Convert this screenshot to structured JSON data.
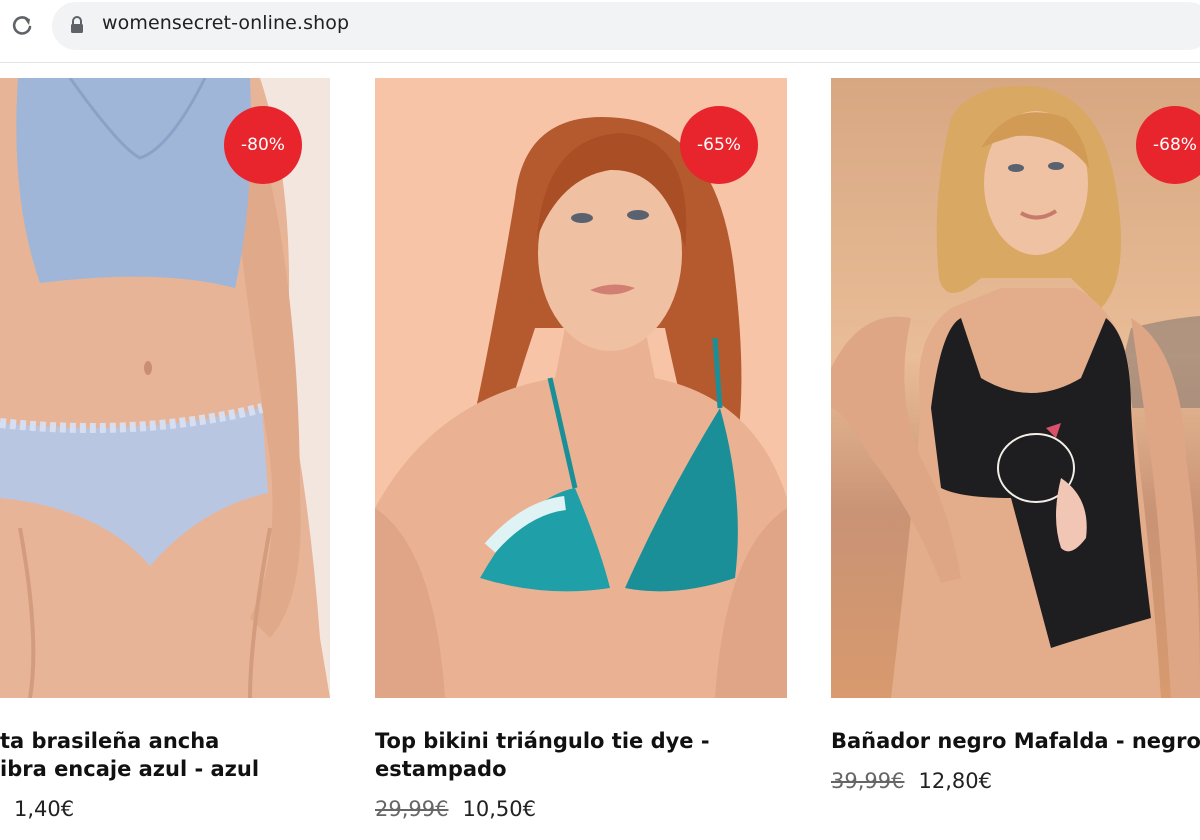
{
  "browser": {
    "url": "womensecret-online.shop"
  },
  "products": [
    {
      "title_line1": "ta brasileña ancha",
      "title_line2": "ibra encaje azul - azul",
      "old_price": "",
      "price": "1,40€",
      "discount": "-80%",
      "image": "model-blue-lingerie"
    },
    {
      "title_line1": "Top bikini triángulo tie dye -",
      "title_line2": "estampado",
      "old_price": "29,99€",
      "price": "10,50€",
      "discount": "-65%",
      "image": "model-tie-dye-bikini"
    },
    {
      "title_line1": "Bañador negro Mafalda - negro",
      "title_line2": "",
      "old_price": "39,99€",
      "price": "12,80€",
      "discount": "-68%",
      "image": "model-black-swimsuit-mafalda"
    }
  ],
  "colors": {
    "badge": "#e8252d",
    "omnibox": "#f1f3f4"
  }
}
